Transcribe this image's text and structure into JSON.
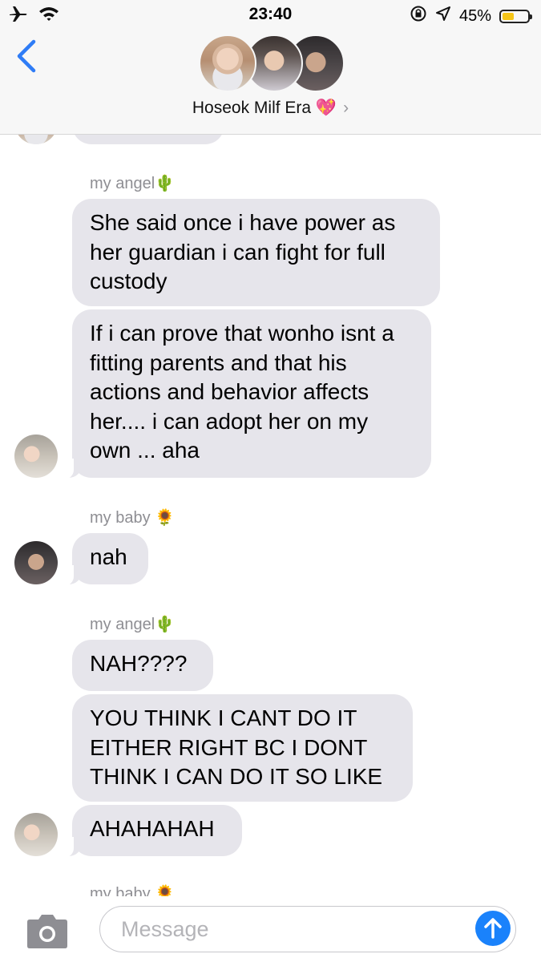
{
  "status_bar": {
    "time": "23:40",
    "battery_percent": "45%",
    "battery_level": 0.45,
    "icons": [
      "airplane-icon",
      "wifi-icon",
      "orientation-lock-icon",
      "location-icon",
      "battery-icon"
    ]
  },
  "header": {
    "back_icon": "chevron-left-icon",
    "group_name": "Hoseok Milf Era 💖",
    "chevron": "›"
  },
  "messages": [
    {
      "sender": "my angel🌵"
    },
    {
      "text": "She said once i have power as her guardian i can fight for full custody"
    },
    {
      "text": "If i can prove that wonho isnt a fitting parents and that his actions and behavior affects her.... i can adopt her on my own ... aha"
    },
    {
      "sender": "my baby 🌻"
    },
    {
      "text": "nah"
    },
    {
      "sender": "my angel🌵"
    },
    {
      "text": "NAH????"
    },
    {
      "text": "YOU THINK I CANT DO IT EITHER RIGHT BC I DONT THINK I CAN DO IT SO LIKE"
    },
    {
      "text": "AHAHAHAH"
    },
    {
      "sender": "my baby 🌻"
    }
  ],
  "input": {
    "placeholder": "Message",
    "camera_icon": "camera-icon",
    "send_icon": "send-arrow-icon",
    "accent": "#1a82fb"
  },
  "colors": {
    "bubble_gray": "#e6e5eb",
    "sender_gray": "#8e8e93",
    "ios_blue": "#2f7cf6"
  }
}
